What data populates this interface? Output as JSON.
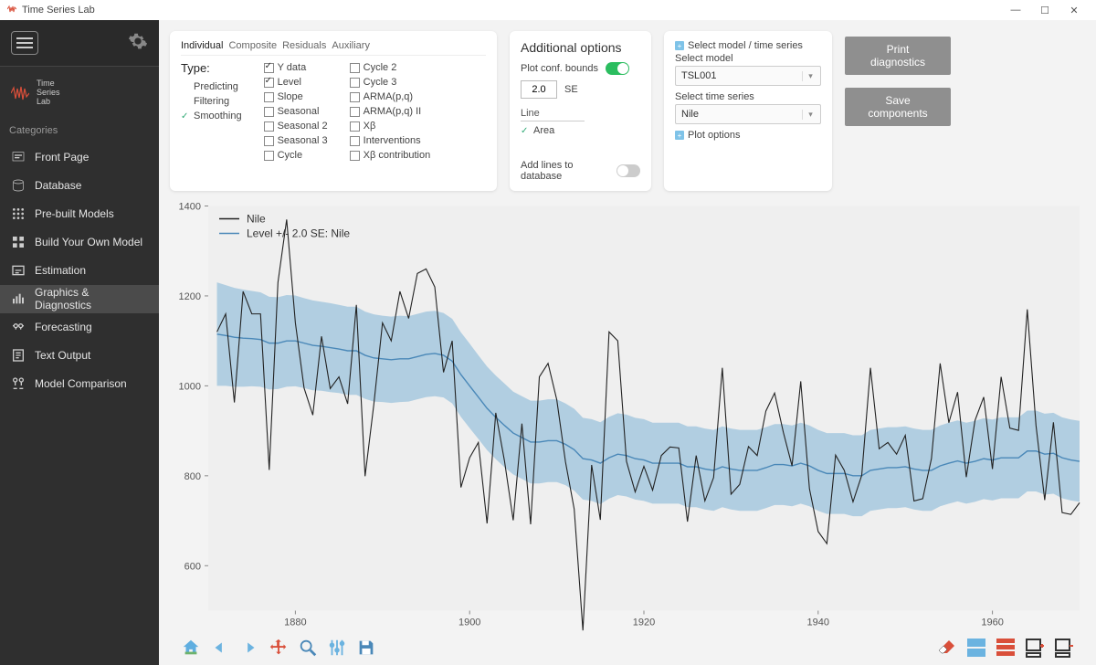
{
  "titlebar": {
    "title": "Time Series Lab"
  },
  "sidebar": {
    "logo_lines": [
      "Time",
      "Series",
      "Lab"
    ],
    "categories_label": "Categories",
    "items": [
      {
        "label": "Front Page"
      },
      {
        "label": "Database"
      },
      {
        "label": "Pre-built Models"
      },
      {
        "label": "Build Your Own Model"
      },
      {
        "label": "Estimation"
      },
      {
        "label": "Graphics & Diagnostics"
      },
      {
        "label": "Forecasting"
      },
      {
        "label": "Text Output"
      },
      {
        "label": "Model Comparison"
      }
    ],
    "active_index": 5
  },
  "tabs": {
    "items": [
      "Individual",
      "Composite",
      "Residuals",
      "Auxiliary"
    ],
    "active_index": 0
  },
  "type_panel": {
    "title": "Type:",
    "modes": [
      "Predicting",
      "Filtering",
      "Smoothing"
    ],
    "active_mode_index": 2,
    "col1": [
      {
        "label": "Y data",
        "checked": true
      },
      {
        "label": "Level",
        "checked": true
      },
      {
        "label": "Slope",
        "checked": false
      },
      {
        "label": "Seasonal",
        "checked": false
      },
      {
        "label": "Seasonal 2",
        "checked": false
      },
      {
        "label": "Seasonal 3",
        "checked": false
      },
      {
        "label": "Cycle",
        "checked": false
      }
    ],
    "col2": [
      {
        "label": "Cycle 2",
        "checked": false
      },
      {
        "label": "Cycle 3",
        "checked": false
      },
      {
        "label": "ARMA(p,q)",
        "checked": false
      },
      {
        "label": "ARMA(p,q) II",
        "checked": false
      },
      {
        "label": "Xβ",
        "checked": false
      },
      {
        "label": "Interventions",
        "checked": false
      },
      {
        "label": "Xβ contribution",
        "checked": false
      }
    ]
  },
  "additional": {
    "title": "Additional options",
    "plot_conf_label": "Plot conf. bounds",
    "plot_conf_on": true,
    "se_value": "2.0",
    "se_suffix": "SE",
    "line_label": "Line",
    "area_label": "Area",
    "add_lines_label": "Add lines to database",
    "add_lines_on": false
  },
  "selection": {
    "select_model_ts_label": "Select model / time series",
    "select_model_label": "Select model",
    "model_value": "TSL001",
    "select_ts_label": "Select time series",
    "ts_value": "Nile",
    "plot_options_label": "Plot options"
  },
  "buttons": {
    "print": "Print diagnostics",
    "save": "Save components"
  },
  "legend": {
    "series1": "Nile",
    "series2": "Level +/- 2.0 SE: Nile"
  },
  "chart_data": {
    "type": "line",
    "xlabel": "",
    "ylabel": "",
    "xlim": [
      1870,
      1970
    ],
    "ylim": [
      500,
      1400
    ],
    "x_ticks": [
      1880,
      1900,
      1920,
      1940,
      1960
    ],
    "y_ticks": [
      600,
      800,
      1000,
      1200,
      1400
    ],
    "series": [
      {
        "name": "Nile",
        "x_start": 1871,
        "x_step": 1,
        "values": [
          1120,
          1160,
          963,
          1210,
          1160,
          1160,
          813,
          1230,
          1370,
          1140,
          995,
          935,
          1110,
          994,
          1020,
          960,
          1180,
          799,
          958,
          1140,
          1100,
          1210,
          1150,
          1250,
          1260,
          1220,
          1030,
          1100,
          774,
          840,
          874,
          694,
          940,
          833,
          701,
          916,
          692,
          1020,
          1050,
          969,
          831,
          726,
          456,
          824,
          702,
          1120,
          1100,
          832,
          764,
          821,
          768,
          845,
          864,
          862,
          698,
          845,
          744,
          796,
          1040,
          759,
          781,
          865,
          845,
          944,
          984,
          897,
          822,
          1010,
          771,
          676,
          649,
          846,
          812,
          742,
          801,
          1040,
          860,
          874,
          848,
          890,
          744,
          749,
          838,
          1050,
          918,
          986,
          797,
          923,
          975,
          815,
          1020,
          906,
          901,
          1170,
          912,
          746,
          919,
          718,
          714,
          740
        ]
      },
      {
        "name": "Level",
        "x_start": 1871,
        "x_step": 1,
        "values": [
          1115,
          1112,
          1108,
          1106,
          1105,
          1103,
          1095,
          1095,
          1100,
          1100,
          1095,
          1090,
          1088,
          1085,
          1082,
          1078,
          1078,
          1068,
          1062,
          1060,
          1058,
          1060,
          1060,
          1065,
          1070,
          1072,
          1068,
          1055,
          1025,
          1000,
          975,
          950,
          930,
          912,
          895,
          885,
          875,
          875,
          878,
          878,
          870,
          858,
          838,
          835,
          828,
          840,
          848,
          845,
          838,
          835,
          828,
          828,
          828,
          828,
          820,
          820,
          815,
          812,
          820,
          815,
          812,
          812,
          812,
          818,
          825,
          825,
          822,
          828,
          822,
          812,
          805,
          805,
          805,
          800,
          800,
          812,
          815,
          818,
          818,
          820,
          815,
          812,
          812,
          822,
          828,
          833,
          828,
          832,
          838,
          835,
          840,
          840,
          840,
          855,
          855,
          848,
          850,
          840,
          835,
          832
        ]
      }
    ],
    "confidence_band": {
      "around_series": "Level",
      "se": 2.0,
      "half_width": [
        115,
        112,
        110,
        108,
        106,
        105,
        103,
        102,
        102,
        101,
        100,
        100,
        99,
        99,
        98,
        98,
        98,
        97,
        97,
        96,
        96,
        96,
        95,
        95,
        95,
        95,
        94,
        94,
        94,
        94,
        93,
        93,
        93,
        93,
        92,
        92,
        92,
        92,
        92,
        92,
        91,
        91,
        91,
        91,
        91,
        91,
        91,
        91,
        91,
        91,
        90,
        90,
        90,
        90,
        90,
        90,
        90,
        90,
        90,
        90,
        90,
        90,
        90,
        90,
        90,
        90,
        90,
        90,
        90,
        90,
        90,
        90,
        90,
        90,
        90,
        90,
        90,
        90,
        90,
        90,
        90,
        90,
        90,
        90,
        90,
        90,
        90,
        90,
        90,
        90,
        90,
        90,
        90,
        90,
        90,
        90,
        90,
        90,
        90,
        90
      ]
    }
  },
  "colors": {
    "band": "#9cc3dc",
    "level_line": "#4a88b8",
    "data_line": "#222222",
    "plot_bg": "#efefef",
    "accent_green": "#2bbd5f"
  }
}
